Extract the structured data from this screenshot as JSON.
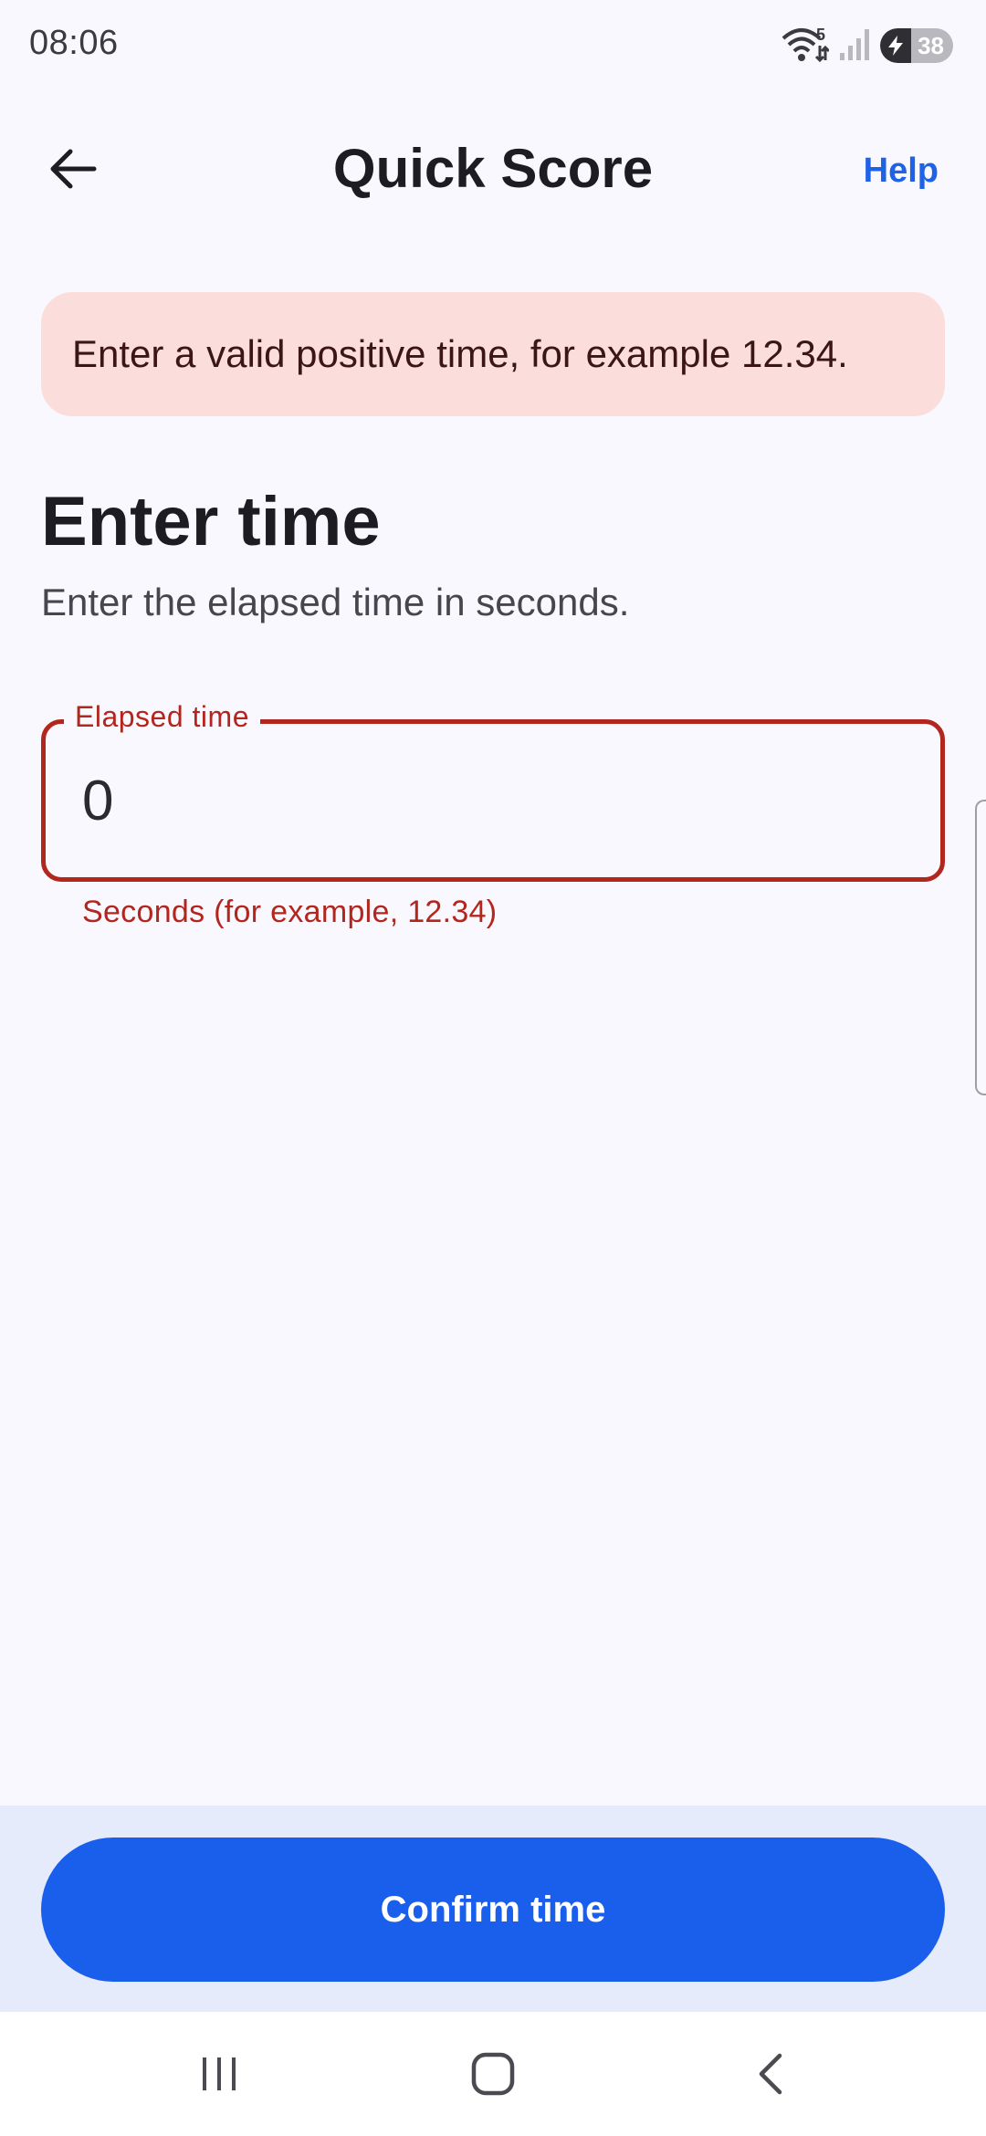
{
  "status_bar": {
    "time": "08:06",
    "wifi_badge": "5",
    "battery_level": "38"
  },
  "app_bar": {
    "title": "Quick Score",
    "help_label": "Help",
    "back_icon": "arrow-left-icon"
  },
  "error_banner": {
    "message": "Enter a valid positive time, for example 12.34."
  },
  "section": {
    "title": "Enter time",
    "description": "Enter the elapsed time in seconds."
  },
  "time_field": {
    "label": "Elapsed time",
    "value": "0",
    "helper_text": "Seconds (for example, 12.34)"
  },
  "actions": {
    "confirm_label": "Confirm time"
  },
  "nav_bar": {
    "icons": [
      "recent-apps-icon",
      "home-icon",
      "back-icon"
    ]
  },
  "colors": {
    "accent": "#1A5FEB",
    "error": "#B3261E",
    "error_container": "#FBDEDC",
    "background": "#F9F8FF"
  }
}
